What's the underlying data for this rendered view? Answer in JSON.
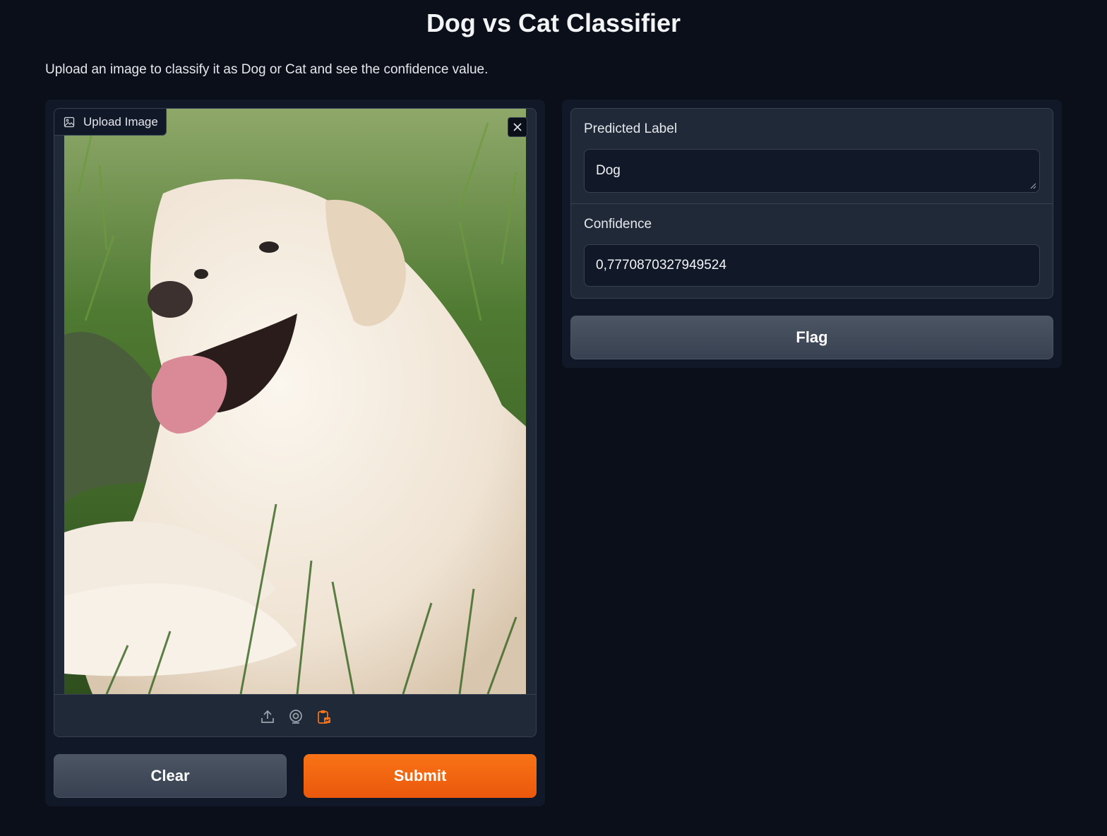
{
  "header": {
    "title": "Dog vs Cat Classifier",
    "description": "Upload an image to classify it as Dog or Cat and see the confidence value."
  },
  "input": {
    "label": "Upload Image",
    "image_alt": "uploaded dog photo",
    "sources": [
      "upload-icon",
      "webcam-icon",
      "clipboard-icon"
    ],
    "active_source": "clipboard-icon"
  },
  "actions": {
    "clear_label": "Clear",
    "submit_label": "Submit",
    "flag_label": "Flag"
  },
  "outputs": {
    "predicted_label_title": "Predicted Label",
    "predicted_label_value": "Dog",
    "confidence_title": "Confidence",
    "confidence_value": "0,7770870327949524"
  },
  "colors": {
    "background": "#0b0f19",
    "panel": "#111827",
    "block": "#1f2937",
    "accent": "#f97316"
  }
}
